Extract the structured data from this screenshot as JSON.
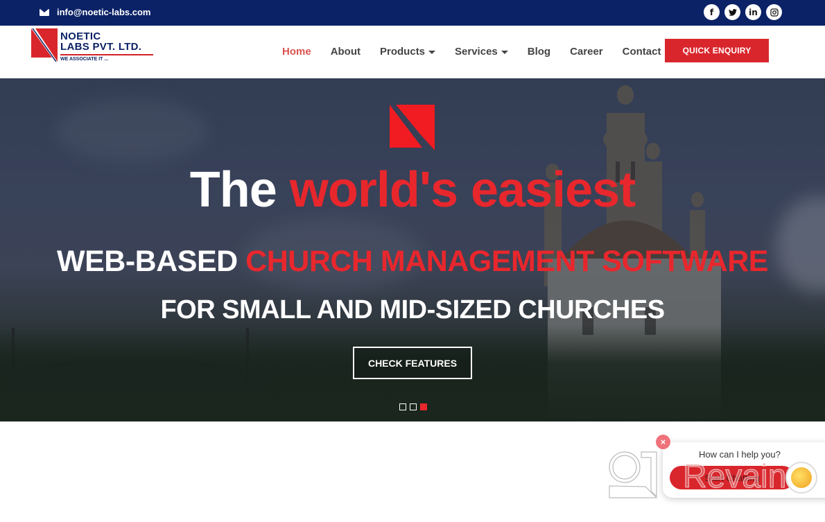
{
  "topbar": {
    "email": "info@noetic-labs.com",
    "email_icon": "envelope-icon",
    "social": [
      {
        "name": "facebook-icon",
        "glyph": "f"
      },
      {
        "name": "twitter-icon",
        "glyph": "🐦"
      },
      {
        "name": "linkedin-icon",
        "glyph": "in"
      },
      {
        "name": "instagram-icon",
        "glyph": "◎"
      }
    ],
    "bg_color": "#0b2266"
  },
  "header": {
    "logo": {
      "line1": "NOETIC",
      "line2": "LABS PVT. LTD.",
      "tagline": "WE ASSOCIATE IT ..."
    },
    "nav": [
      {
        "label": "Home",
        "active": true,
        "dropdown": false
      },
      {
        "label": "About",
        "active": false,
        "dropdown": false
      },
      {
        "label": "Products",
        "active": false,
        "dropdown": true
      },
      {
        "label": "Services",
        "active": false,
        "dropdown": true
      },
      {
        "label": "Blog",
        "active": false,
        "dropdown": false
      },
      {
        "label": "Career",
        "active": false,
        "dropdown": false
      },
      {
        "label": "Contact",
        "active": false,
        "dropdown": false
      }
    ],
    "cta_label": "QUICK ENQUIRY",
    "accent_color": "#d9262c"
  },
  "hero": {
    "headline_white": "The",
    "headline_red": "world's easiest",
    "sub1_white": "WEB-BASED",
    "sub1_red": "CHURCH MANAGEMENT SOFTWARE",
    "sub2": "FOR SMALL AND MID-SIZED CHURCHES",
    "cta_label": "CHECK FEATURES",
    "slides": {
      "count": 3,
      "active": 3
    }
  },
  "chat_widget": {
    "question": "How can I help you?",
    "button_label": "Start Chatting",
    "close_glyph": "×",
    "watermark_text": "Revain"
  }
}
